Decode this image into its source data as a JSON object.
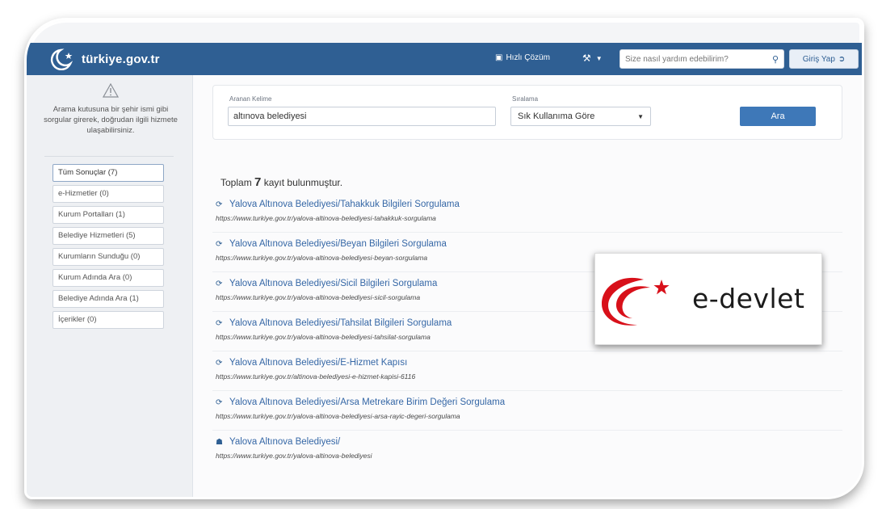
{
  "header": {
    "logo_text": "türkiye.gov.tr",
    "quick_solution": "Hızlı Çözüm",
    "search_placeholder": "Size nasıl yardım edebilirim?",
    "login_label": "Giriş Yap",
    "color": "#2f5f93"
  },
  "sidebar": {
    "hint": "Arama kutusuna bir şehir ismi gibi sorgular girerek, doğrudan ilgili hizmete ulaşabilirsiniz.",
    "filters": [
      {
        "label": "Tüm Sonuçlar (7)",
        "active": true
      },
      {
        "label": "e-Hizmetler (0)"
      },
      {
        "label": "Kurum Portalları (1)"
      },
      {
        "label": "Belediye Hizmetleri (5)"
      },
      {
        "label": "Kurumların Sunduğu (0)"
      },
      {
        "label": "Kurum Adında Ara (0)"
      },
      {
        "label": "Belediye Adında Ara (1)"
      },
      {
        "label": "İçerikler (0)"
      }
    ]
  },
  "search": {
    "keyword_label": "Aranan Kelime",
    "keyword_value": "altınova belediyesi",
    "sort_label": "Sıralama",
    "sort_value": "Sık Kullanıma Göre",
    "button_label": "Ara",
    "button_color": "#3e78b8"
  },
  "results": {
    "total_prefix": "Toplam",
    "total_count": "7",
    "total_suffix": "kayıt bulunmuştur.",
    "items": [
      {
        "title": "Yalova Altınova Belediyesi/Tahakkuk Bilgileri Sorgulama",
        "url": "https://www.turkiye.gov.tr/yalova-altinova-belediyesi-tahakkuk-sorgulama",
        "icon": "link-icon"
      },
      {
        "title": "Yalova Altınova Belediyesi/Beyan Bilgileri Sorgulama",
        "url": "https://www.turkiye.gov.tr/yalova-altinova-belediyesi-beyan-sorgulama",
        "icon": "link-icon"
      },
      {
        "title": "Yalova Altınova Belediyesi/Sicil Bilgileri Sorgulama",
        "url": "https://www.turkiye.gov.tr/yalova-altinova-belediyesi-sicil-sorgulama",
        "icon": "link-icon"
      },
      {
        "title": "Yalova Altınova Belediyesi/Tahsilat Bilgileri Sorgulama",
        "url": "https://www.turkiye.gov.tr/yalova-altinova-belediyesi-tahsilat-sorgulama",
        "icon": "link-icon"
      },
      {
        "title": "Yalova Altınova Belediyesi/E-Hizmet Kapısı",
        "url": "https://www.turkiye.gov.tr/altinova-belediyesi-e-hizmet-kapisi-6116",
        "icon": "link-icon"
      },
      {
        "title": "Yalova Altınova Belediyesi/Arsa Metrekare Birim Değeri Sorgulama",
        "url": "https://www.turkiye.gov.tr/yalova-altinova-belediyesi-arsa-rayic-degeri-sorgulama",
        "icon": "link-icon"
      },
      {
        "title": "Yalova Altınova Belediyesi/",
        "url": "https://www.turkiye.gov.tr/yalova-altinova-belediyesi",
        "icon": "building-icon"
      }
    ]
  },
  "edevlet_logo": {
    "text": "e-devlet",
    "color": "#d8101a"
  }
}
